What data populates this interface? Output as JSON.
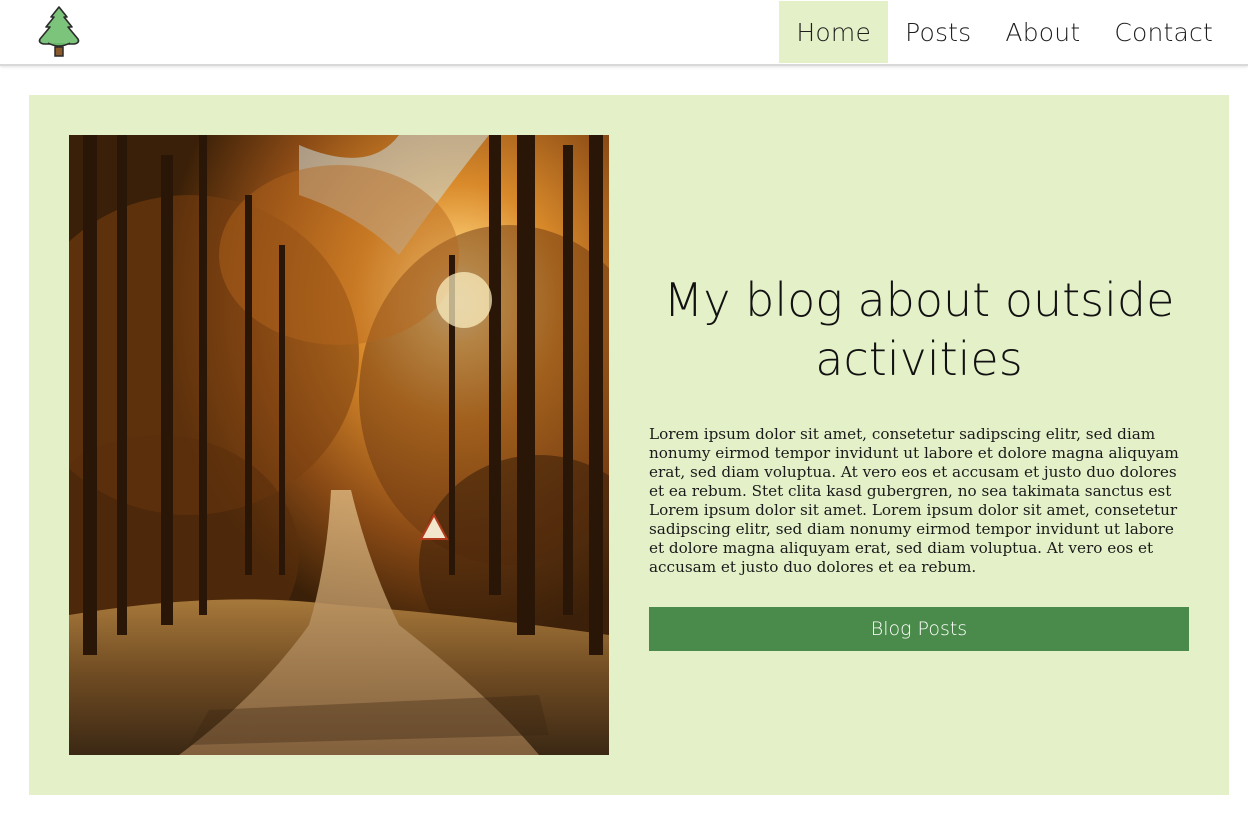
{
  "nav": {
    "logo_icon": "pine-tree-icon",
    "items": [
      {
        "label": "Home",
        "active": true
      },
      {
        "label": "Posts",
        "active": false
      },
      {
        "label": "About",
        "active": false
      },
      {
        "label": "Contact",
        "active": false
      }
    ]
  },
  "hero": {
    "image_description_icon": "forest-path-photo",
    "title": "My blog about outside activities",
    "body": "Lorem ipsum dolor sit amet, consetetur sadipscing elitr, sed diam nonumy eirmod tempor invidunt ut labore et dolore magna aliquyam erat, sed diam voluptua. At vero eos et accusam et justo duo dolores et ea rebum. Stet clita kasd gubergren, no sea takimata sanctus est Lorem ipsum dolor sit amet. Lorem ipsum dolor sit amet, consetetur sadipscing elitr, sed diam nonumy eirmod tempor invidunt ut labore et dolore magna aliquyam erat, sed diam voluptua. At vero eos et accusam et justo duo dolores et ea rebum.",
    "button_label": "Blog Posts"
  },
  "colors": {
    "accent_bg": "#e4f0c8",
    "button": "#4a8a4a",
    "text": "#1e1e1e"
  }
}
